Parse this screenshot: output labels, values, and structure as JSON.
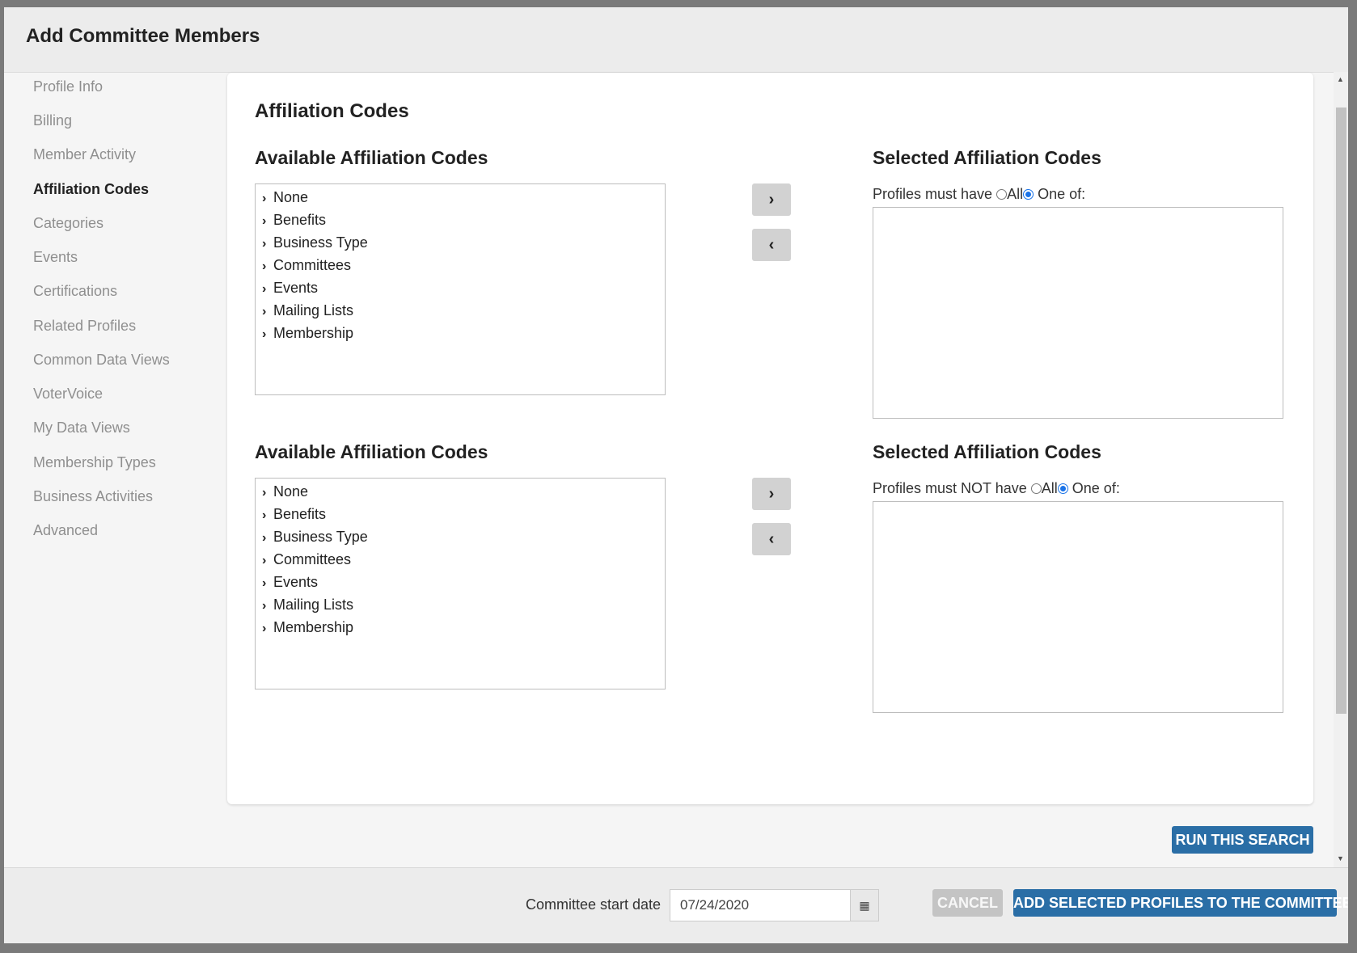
{
  "modal": {
    "title": "Add Committee Members"
  },
  "sidebar": {
    "items": [
      {
        "label": "Profile Info"
      },
      {
        "label": "Billing"
      },
      {
        "label": "Member Activity"
      },
      {
        "label": "Affiliation Codes",
        "active": true
      },
      {
        "label": "Categories"
      },
      {
        "label": "Events"
      },
      {
        "label": "Certifications"
      },
      {
        "label": "Related Profiles"
      },
      {
        "label": "Common Data Views"
      },
      {
        "label": "VoterVoice"
      },
      {
        "label": "My Data Views"
      },
      {
        "label": "Membership Types"
      },
      {
        "label": "Business Activities"
      },
      {
        "label": "Advanced"
      }
    ]
  },
  "panel": {
    "title": "Affiliation Codes",
    "section1": {
      "available_title": "Available Affiliation Codes",
      "selected_title": "Selected Affiliation Codes",
      "must_label": "Profiles must have",
      "all_label": "All",
      "one_of_label": "One of:",
      "selected_option": "one_of",
      "items": [
        "None",
        "Benefits",
        "Business Type",
        "Committees",
        "Events",
        "Mailing Lists",
        "Membership"
      ]
    },
    "section2": {
      "available_title": "Available Affiliation Codes",
      "selected_title": "Selected Affiliation Codes",
      "must_label": "Profiles must NOT have",
      "all_label": "All",
      "one_of_label": "One of:",
      "selected_option": "one_of",
      "items": [
        "None",
        "Benefits",
        "Business Type",
        "Committees",
        "Events",
        "Mailing Lists",
        "Membership"
      ]
    },
    "move_right_icon": "chevron-right-icon",
    "move_left_icon": "chevron-left-icon"
  },
  "run_search_label": "RUN THIS SEARCH",
  "footer": {
    "date_label": "Committee start date",
    "date_value": "07/24/2020",
    "calendar_icon": "calendar-icon",
    "cancel_label": "CANCEL",
    "add_label": "ADD SELECTED PROFILES TO THE COMMITTEE"
  },
  "colors": {
    "primary": "#2a6ea6",
    "radio_checked": "#1a73e8",
    "disabled": "#c4c4c4"
  }
}
